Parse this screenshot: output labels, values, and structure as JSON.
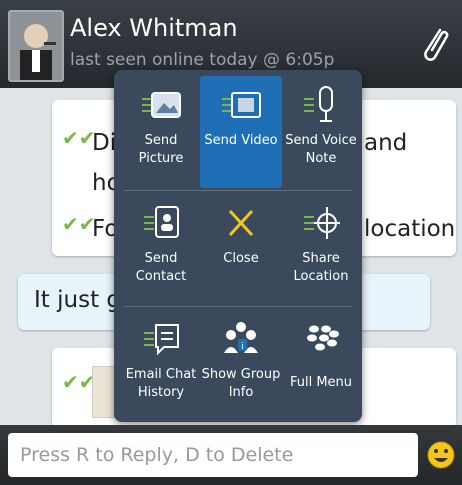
{
  "header": {
    "contact_name": "Alex Whitman",
    "status": "last seen online today @ 6:05p"
  },
  "messages": {
    "out_1_line_1": "Di",
    "out_1_line_1_tail": "and",
    "out_1_line_2": "ho",
    "out_1_line_3": "Fo",
    "out_1_line_3_tail": "location",
    "in_1": "It just ge"
  },
  "menu": {
    "items": [
      {
        "label": "Send Picture",
        "icon": "picture-icon"
      },
      {
        "label": "Send Video",
        "icon": "video-icon",
        "selected": true
      },
      {
        "label": "Send Voice Note",
        "icon": "microphone-icon"
      },
      {
        "label": "Send Contact",
        "icon": "contact-icon"
      },
      {
        "label": "Close",
        "icon": "close-icon"
      },
      {
        "label": "Share Location",
        "icon": "location-icon"
      },
      {
        "label": "Email Chat History",
        "icon": "chat-icon"
      },
      {
        "label": "Show Group Info",
        "icon": "group-icon"
      },
      {
        "label": "Full Menu",
        "icon": "blackberry-icon"
      }
    ]
  },
  "reply": {
    "placeholder": "Press R to Reply, D to Delete"
  },
  "colors": {
    "accent": "#1e6fb5",
    "check": "#7ab648",
    "close_x": "#f5c518"
  }
}
